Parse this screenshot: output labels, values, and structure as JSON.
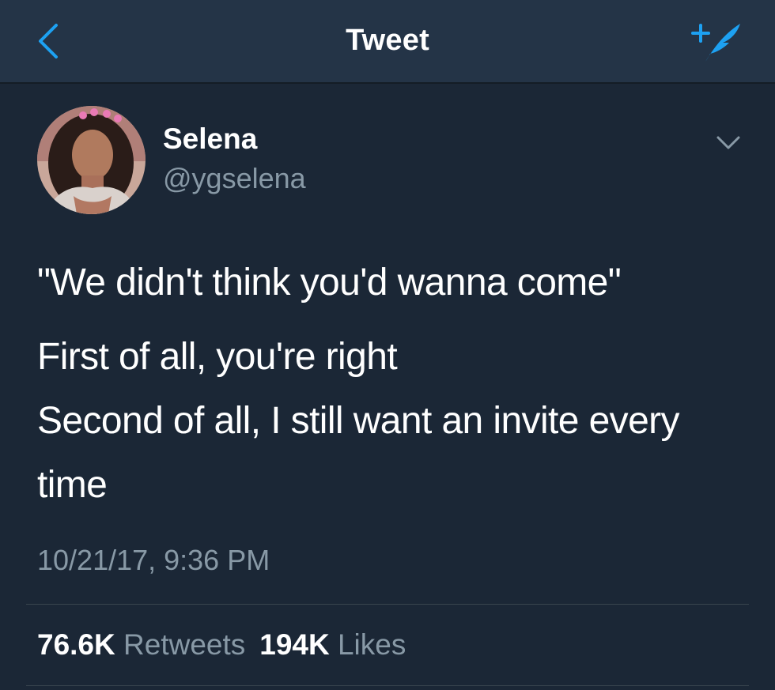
{
  "colors": {
    "background": "#1b2736",
    "navbar": "#243447",
    "accent": "#1da1f2",
    "secondary_text": "#8899a6",
    "divider": "#38444d"
  },
  "navbar": {
    "title": "Tweet",
    "back_icon": "chevron-left-icon",
    "compose_icon": "compose-tweet-icon"
  },
  "author": {
    "display_name": "Selena",
    "handle": "@ygselena",
    "avatar_icon": "avatar",
    "menu_icon": "chevron-down-icon"
  },
  "tweet": {
    "paragraph_1": "\"We didn't think you'd wanna come\"",
    "line_2": "First of all, you're right",
    "line_3": "Second of all, I still want an invite every",
    "line_4": "time",
    "timestamp": "10/21/17, 9:36 PM"
  },
  "stats": {
    "retweets_count": "76.6K",
    "retweets_label": "Retweets",
    "likes_count": "194K",
    "likes_label": "Likes"
  }
}
